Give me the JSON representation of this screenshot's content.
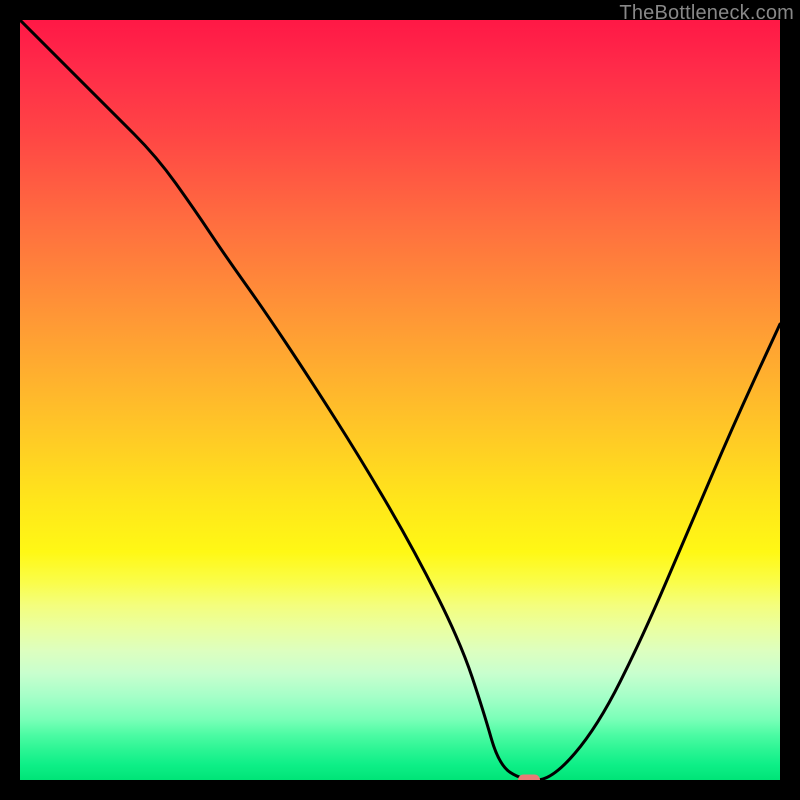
{
  "watermark": "TheBottleneck.com",
  "colors": {
    "page_bg": "#000000",
    "watermark": "#888888",
    "curve": "#000000",
    "marker": "#e77b76"
  },
  "chart_data": {
    "type": "line",
    "title": "",
    "xlabel": "",
    "ylabel": "",
    "xlim": [
      0,
      100
    ],
    "ylim": [
      0,
      100
    ],
    "grid": false,
    "legend": false,
    "annotations": [
      {
        "type": "watermark",
        "text": "TheBottleneck.com",
        "position": "top-right"
      }
    ],
    "gradient_stops": [
      {
        "pct": 0,
        "color": "#ff1846"
      },
      {
        "pct": 15,
        "color": "#ff4545"
      },
      {
        "pct": 40,
        "color": "#ff9a35"
      },
      {
        "pct": 63,
        "color": "#ffe51b"
      },
      {
        "pct": 80,
        "color": "#eaffa0"
      },
      {
        "pct": 92,
        "color": "#7affb8"
      },
      {
        "pct": 100,
        "color": "#00e477"
      }
    ],
    "series": [
      {
        "name": "bottleneck-curve",
        "x": [
          0,
          6,
          12,
          18,
          23,
          27,
          32,
          38,
          45,
          52,
          58,
          61,
          63,
          66,
          70,
          76,
          82,
          88,
          94,
          100
        ],
        "values": [
          100,
          94,
          88,
          82,
          75,
          69,
          62,
          53,
          42,
          30,
          18,
          9,
          2,
          0,
          0,
          7,
          19,
          33,
          47,
          60
        ]
      }
    ],
    "marker": {
      "x": 67,
      "y": 0
    }
  }
}
